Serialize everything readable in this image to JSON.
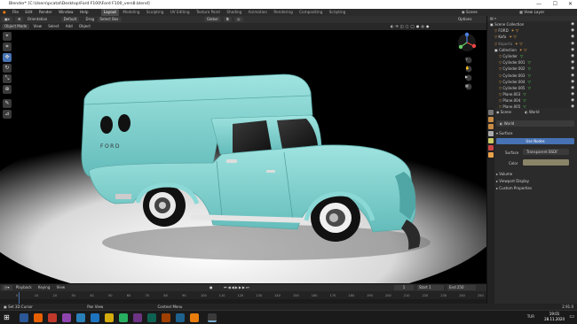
{
  "window": {
    "title": "Blender* [C:\\Users\\pcatal\\Desktop\\Ford F100\\Ford F100_vers8.blend]",
    "min": "—",
    "max": "☐",
    "close": "✕"
  },
  "menu": {
    "items": [
      "File",
      "Edit",
      "Render",
      "Window",
      "Help"
    ],
    "workspaces": [
      "Layout",
      "Modeling",
      "Sculpting",
      "UV Editing",
      "Texture Paint",
      "Shading",
      "Animation",
      "Rendering",
      "Compositing",
      "Scripting"
    ],
    "active_workspace": "Layout",
    "scene_label": "Scene",
    "view_layer_label": "View Layer"
  },
  "header": {
    "orientation_label": "Orientation",
    "orientation_value": "Default",
    "drag_label": "Drag",
    "drag_value": "Select Box",
    "pivot": "Global",
    "options": "Options"
  },
  "viewport_header": {
    "mode": "Object Mode",
    "items": [
      "View",
      "Select",
      "Add",
      "Object"
    ]
  },
  "tools": [
    "cursor",
    "move",
    "rotate",
    "scale",
    "transform",
    "annotate",
    "measure"
  ],
  "outliner": {
    "rows": [
      {
        "label": "Scene Collection",
        "indent": 0,
        "icon": "collection-icon"
      },
      {
        "label": "FORD",
        "indent": 1,
        "icon": "mesh-icon"
      },
      {
        "label": "Kafa",
        "indent": 1,
        "icon": "mesh-icon"
      },
      {
        "label": "Kaporta",
        "indent": 1,
        "icon": "mesh-icon"
      },
      {
        "label": "Collection",
        "indent": 1,
        "icon": "collection-icon"
      },
      {
        "label": "Cylinder",
        "indent": 2,
        "icon": "mesh-icon"
      },
      {
        "label": "Cylinder.001",
        "indent": 2,
        "icon": "mesh-icon"
      },
      {
        "label": "Cylinder.002",
        "indent": 2,
        "icon": "mesh-icon"
      },
      {
        "label": "Cylinder.003",
        "indent": 2,
        "icon": "mesh-icon"
      },
      {
        "label": "Cylinder.004",
        "indent": 2,
        "icon": "mesh-icon"
      },
      {
        "label": "Cylinder.005",
        "indent": 2,
        "icon": "mesh-icon"
      },
      {
        "label": "Plane.003",
        "indent": 2,
        "icon": "mesh-icon"
      },
      {
        "label": "Plane.004",
        "indent": 2,
        "icon": "mesh-icon"
      },
      {
        "label": "Plane.005",
        "indent": 2,
        "icon": "mesh-icon"
      }
    ]
  },
  "properties": {
    "scene_tab": "Scene",
    "world_tab": "World",
    "world_name": "World",
    "surface_section": "Surface",
    "use_nodes": "Use Nodes",
    "surface_label": "Surface",
    "surface_value": "Transparent BSDF",
    "color_label": "Color",
    "color_value": "#8a8468",
    "sections": [
      "Volume",
      "Viewport Display",
      "Custom Properties"
    ]
  },
  "timeline": {
    "menu": [
      "Playback",
      "Keying",
      "View"
    ],
    "frame_current": "1",
    "start_label": "Start",
    "start": "1",
    "end_label": "End",
    "end": "250",
    "ticks": [
      "0",
      "10",
      "20",
      "30",
      "40",
      "50",
      "60",
      "70",
      "80",
      "90",
      "100",
      "110",
      "120",
      "130",
      "140",
      "150",
      "160",
      "170",
      "180",
      "190",
      "200",
      "210",
      "220",
      "230",
      "240",
      "250"
    ]
  },
  "status": {
    "left": "Set 3D Cursor",
    "middle": "Pan View",
    "right": "Context Menu",
    "version": "2.91.0"
  },
  "taskbar": {
    "time": "19:01",
    "date": "28.11.2020",
    "lang": "TUR"
  },
  "truck": {
    "body_color": "#7fd3d1",
    "trim_color": "#d8d8d8",
    "badge": "FORD"
  }
}
